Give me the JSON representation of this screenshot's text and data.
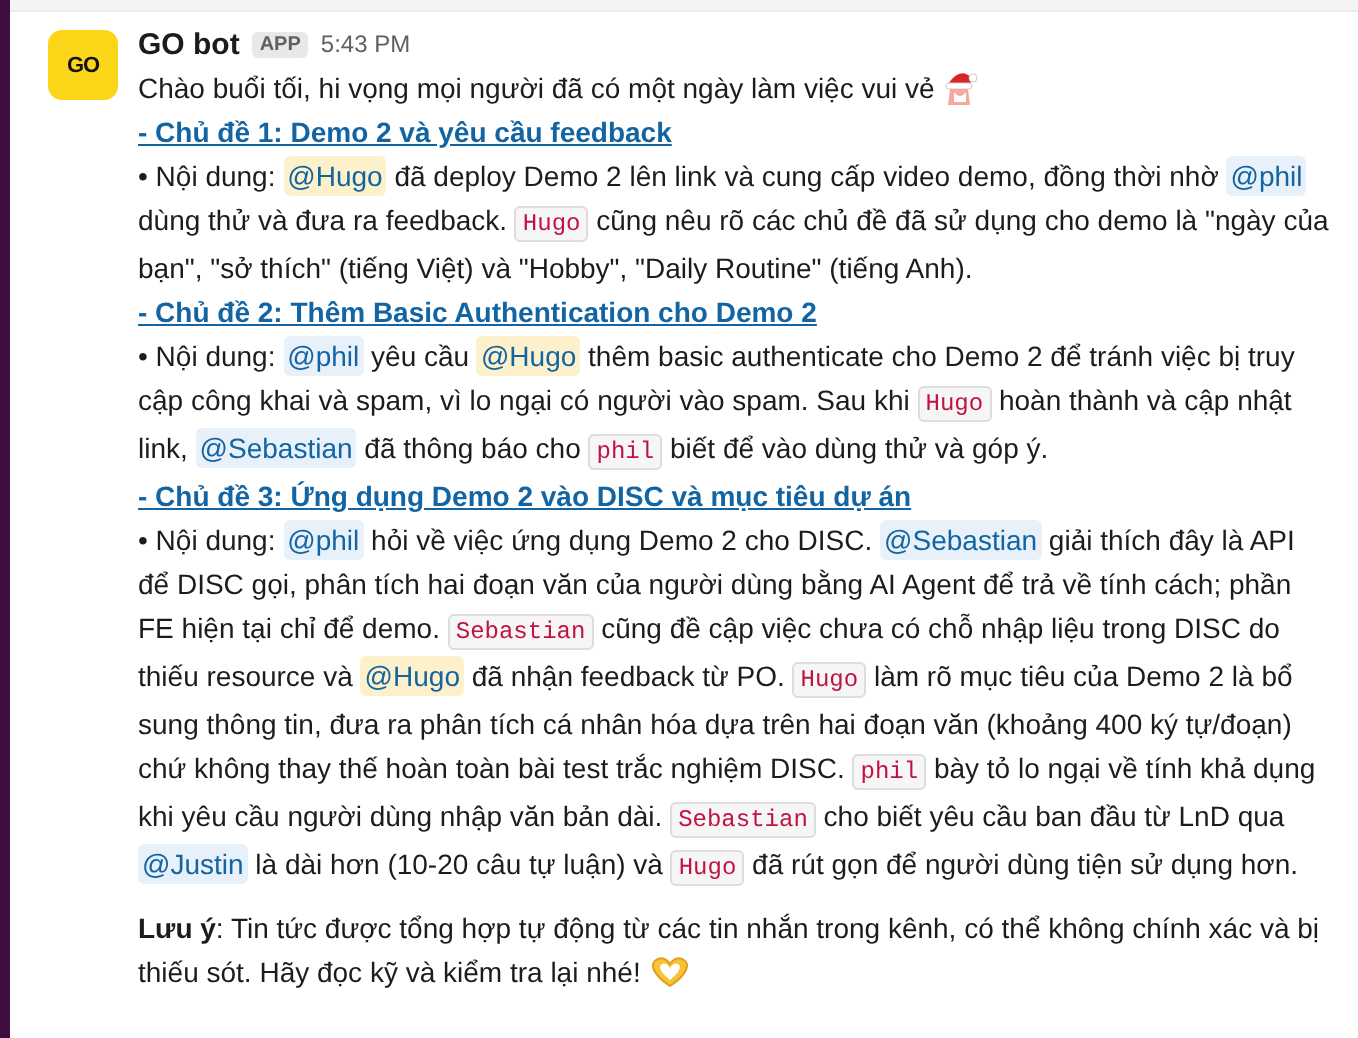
{
  "message": {
    "sender": "GO bot",
    "badge": "APP",
    "time": "5:43 PM",
    "avatar_text": "GO",
    "blocks": [
      {
        "kind": "paragraph",
        "segments": [
          {
            "kind": "text",
            "text": "Chào buổi tối, hi vọng mọi người đã có một ngày làm việc vui vẻ "
          },
          {
            "kind": "santa-emoji"
          }
        ]
      },
      {
        "kind": "heading",
        "text": "- Chủ đề 1: Demo 2 và yêu cầu feedback"
      },
      {
        "kind": "paragraph",
        "segments": [
          {
            "kind": "text",
            "text": "• Nội dung: "
          },
          {
            "kind": "mention",
            "text": "@Hugo",
            "highlighted": true
          },
          {
            "kind": "text",
            "text": " đã deploy Demo 2 lên link và cung cấp video demo, đồng thời nhờ "
          },
          {
            "kind": "mention",
            "text": "@phil",
            "highlighted": false
          },
          {
            "kind": "text",
            "text": " dùng thử và đưa ra feedback. "
          },
          {
            "kind": "code",
            "text": "Hugo"
          },
          {
            "kind": "text",
            "text": " cũng nêu rõ các chủ đề đã sử dụng cho demo là \"ngày của bạn\", \"sở thích\" (tiếng Việt) và \"Hobby\", \"Daily Routine\" (tiếng Anh)."
          }
        ]
      },
      {
        "kind": "heading",
        "text": "- Chủ đề 2: Thêm Basic Authentication cho Demo 2"
      },
      {
        "kind": "paragraph",
        "segments": [
          {
            "kind": "text",
            "text": "• Nội dung: "
          },
          {
            "kind": "mention",
            "text": "@phil",
            "highlighted": false
          },
          {
            "kind": "text",
            "text": " yêu cầu "
          },
          {
            "kind": "mention",
            "text": "@Hugo",
            "highlighted": true
          },
          {
            "kind": "text",
            "text": " thêm basic authenticate cho Demo 2 để tránh việc bị truy cập công khai và spam, vì lo ngại có người vào spam. Sau khi "
          },
          {
            "kind": "code",
            "text": "Hugo"
          },
          {
            "kind": "text",
            "text": " hoàn thành và cập nhật link, "
          },
          {
            "kind": "mention",
            "text": "@Sebastian",
            "highlighted": false
          },
          {
            "kind": "text",
            "text": " đã thông báo cho "
          },
          {
            "kind": "code",
            "text": "phil"
          },
          {
            "kind": "text",
            "text": " biết để vào dùng thử và góp ý."
          }
        ]
      },
      {
        "kind": "heading",
        "text": "- Chủ đề 3: Ứng dụng Demo 2 vào DISC và mục tiêu dự án"
      },
      {
        "kind": "paragraph",
        "segments": [
          {
            "kind": "text",
            "text": "• Nội dung: "
          },
          {
            "kind": "mention",
            "text": "@phil",
            "highlighted": false
          },
          {
            "kind": "text",
            "text": " hỏi về việc ứng dụng Demo 2 cho DISC. "
          },
          {
            "kind": "mention",
            "text": "@Sebastian",
            "highlighted": false
          },
          {
            "kind": "text",
            "text": " giải thích đây là API để DISC gọi, phân tích hai đoạn văn của người dùng bằng AI Agent để trả về tính cách; phần FE hiện tại chỉ để demo. "
          },
          {
            "kind": "code",
            "text": "Sebastian"
          },
          {
            "kind": "text",
            "text": " cũng đề cập việc chưa có chỗ nhập liệu trong DISC do thiếu resource và "
          },
          {
            "kind": "mention",
            "text": "@Hugo",
            "highlighted": true
          },
          {
            "kind": "text",
            "text": " đã nhận feedback từ PO. "
          },
          {
            "kind": "code",
            "text": "Hugo"
          },
          {
            "kind": "text",
            "text": " làm rõ mục tiêu của Demo 2 là bổ sung thông tin, đưa ra phân tích cá nhân hóa dựa trên hai đoạn văn (khoảng 400 ký tự/đoạn) chứ không thay thế hoàn toàn bài test trắc nghiệm DISC. "
          },
          {
            "kind": "code",
            "text": "phil"
          },
          {
            "kind": "text",
            "text": " bày tỏ lo ngại về tính khả dụng khi yêu cầu người dùng nhập văn bản dài. "
          },
          {
            "kind": "code",
            "text": "Sebastian"
          },
          {
            "kind": "text",
            "text": " cho biết yêu cầu ban đầu từ LnD qua "
          },
          {
            "kind": "mention",
            "text": "@Justin",
            "highlighted": false
          },
          {
            "kind": "text",
            "text": " là dài hơn (10-20 câu tự luận) và "
          },
          {
            "kind": "code",
            "text": "Hugo"
          },
          {
            "kind": "text",
            "text": " đã rút gọn để người dùng tiện sử dụng hơn."
          }
        ]
      },
      {
        "kind": "note",
        "segments": [
          {
            "kind": "text",
            "text": "**Lưu ý**: Tin tức được tổng hợp tự động từ các tin nhắn trong kênh, có thể không chính xác và bị thiếu sót. Hãy đọc kỹ và kiểm tra lại nhé! "
          },
          {
            "kind": "heart-emoji"
          }
        ]
      }
    ]
  }
}
